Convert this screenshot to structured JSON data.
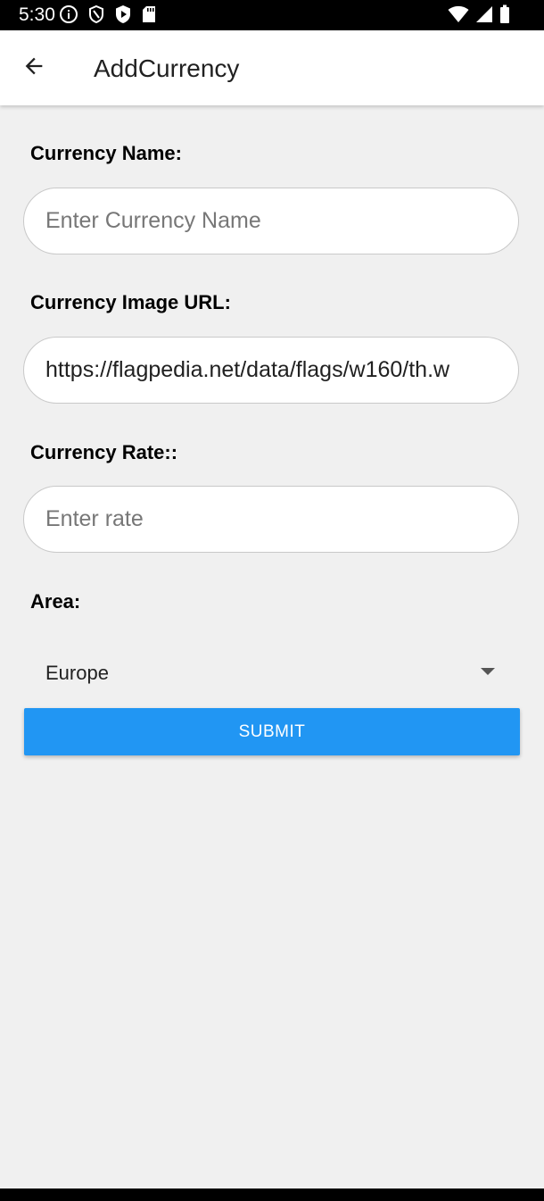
{
  "status_bar": {
    "time": "5:30",
    "left_icons": [
      "info-icon",
      "shield-icon",
      "play-protect-icon",
      "sd-card-icon"
    ],
    "right_icons": [
      "wifi-icon",
      "cell-signal-icon",
      "battery-icon"
    ]
  },
  "app_bar": {
    "title": "AddCurrency",
    "back_icon": "arrow-back-icon"
  },
  "form": {
    "currency_name": {
      "label": "Currency Name:",
      "value": "",
      "placeholder": "Enter Currency Name"
    },
    "image_url": {
      "label": "Currency Image URL:",
      "value": "https://flagpedia.net/data/flags/w160/th.w",
      "placeholder": ""
    },
    "rate": {
      "label": "Currency Rate::",
      "value": "",
      "placeholder": "Enter rate"
    },
    "area": {
      "label": "Area:",
      "selected": "Europe"
    },
    "submit_label": "SUBMIT"
  },
  "colors": {
    "accent": "#2196f3",
    "background": "#f0f0f0",
    "app_bar": "#ffffff",
    "status_bar": "#000000"
  }
}
